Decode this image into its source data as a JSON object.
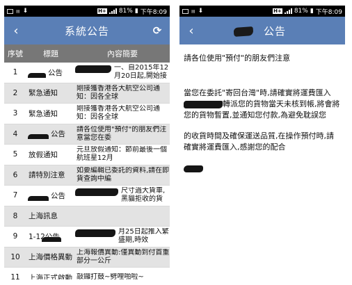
{
  "statusbar": {
    "battery": "81%",
    "time": "下午8:09"
  },
  "left": {
    "title": "系統公告",
    "back_icon": "‹",
    "refresh_icon": "⟳",
    "columns": [
      "序號",
      "標題",
      "內容簡要"
    ],
    "rows": [
      {
        "no": "1",
        "title": "公告",
        "content": "一、自2015年12月20日起,開始接"
      },
      {
        "no": "2",
        "title": "緊急通知",
        "content": "剛接獲香港各大航空公司通知：因各全球"
      },
      {
        "no": "3",
        "title": "緊急通知",
        "content": "剛接獲香港各大航空公司通知：因各全球"
      },
      {
        "no": "4",
        "title": "公告",
        "content": "請各位使用\"預付\"的朋友們注意當您在委"
      },
      {
        "no": "5",
        "title": "放假通知",
        "content": "元旦放假通知：節前最後一個航班星12月"
      },
      {
        "no": "6",
        "title": "請特別注意",
        "content": "如要編輯已委託的資料,請在即貨查詢中編"
      },
      {
        "no": "7",
        "title": "公告",
        "content": "尺寸過大貨車,黑貓拒收的貨"
      },
      {
        "no": "8",
        "title": "上海訊息",
        "content": ""
      },
      {
        "no": "9",
        "title": "1-12公告",
        "content": "月25日起推入繁盛期,時效"
      },
      {
        "no": "10",
        "title": "上海價格異動",
        "content": "上海報價異動:僅異動到付首重部分一公斤"
      },
      {
        "no": "11",
        "title": "上海正式啟動",
        "content": "敲鑼打鼓~劈哩啪啦~"
      }
    ]
  },
  "right": {
    "title": "公告",
    "back_icon": "‹",
    "para1": "請各位使用\"預付\"的朋友們注意",
    "para2_a": "當您在委託\"寄回台灣\"時,請確實將運費匯入",
    "para2_b": "轉派您的貨物當天未核到帳,將會將您的貨物暫置,並通知您付款,為避免耽誤您",
    "para3": "的收貨時間及確保運送品質,在操作預付時,請確實將運費匯入,感謝您的配合"
  }
}
